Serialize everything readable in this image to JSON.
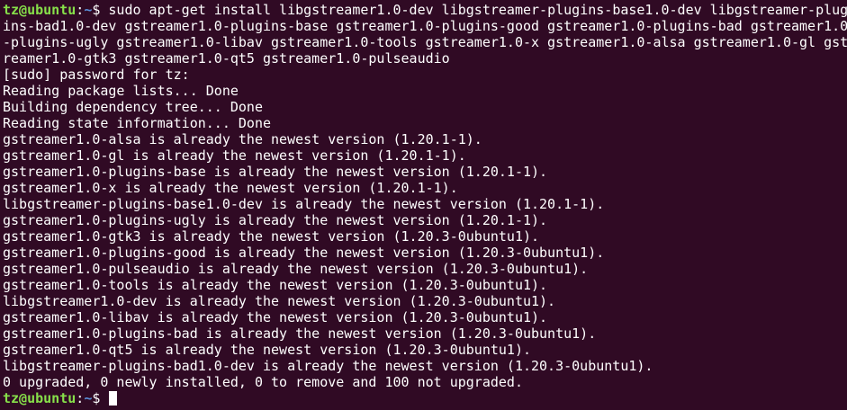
{
  "colors": {
    "background": "#300a24",
    "text": "#ffffff",
    "prompt_user": "#87e04a",
    "prompt_path": "#5a8fd8"
  },
  "prompt": {
    "user_host": "tz@ubuntu",
    "separator": ":",
    "path": "~",
    "symbol": "$ "
  },
  "command_lines": [
    "sudo apt-get install libgstreamer1.0-dev libgstreamer-plugins-base1.0-dev libgstreamer-plug",
    "ins-bad1.0-dev gstreamer1.0-plugins-base gstreamer1.0-plugins-good gstreamer1.0-plugins-bad gstreamer1.0",
    "-plugins-ugly gstreamer1.0-libav gstreamer1.0-tools gstreamer1.0-x gstreamer1.0-alsa gstreamer1.0-gl gst",
    "reamer1.0-gtk3 gstreamer1.0-qt5 gstreamer1.0-pulseaudio"
  ],
  "output_lines": [
    "[sudo] password for tz:",
    "Reading package lists... Done",
    "Building dependency tree... Done",
    "Reading state information... Done",
    "gstreamer1.0-alsa is already the newest version (1.20.1-1).",
    "gstreamer1.0-gl is already the newest version (1.20.1-1).",
    "gstreamer1.0-plugins-base is already the newest version (1.20.1-1).",
    "gstreamer1.0-x is already the newest version (1.20.1-1).",
    "libgstreamer-plugins-base1.0-dev is already the newest version (1.20.1-1).",
    "gstreamer1.0-plugins-ugly is already the newest version (1.20.1-1).",
    "gstreamer1.0-gtk3 is already the newest version (1.20.3-0ubuntu1).",
    "gstreamer1.0-plugins-good is already the newest version (1.20.3-0ubuntu1).",
    "gstreamer1.0-pulseaudio is already the newest version (1.20.3-0ubuntu1).",
    "gstreamer1.0-tools is already the newest version (1.20.3-0ubuntu1).",
    "libgstreamer1.0-dev is already the newest version (1.20.3-0ubuntu1).",
    "gstreamer1.0-libav is already the newest version (1.20.3-0ubuntu1).",
    "gstreamer1.0-plugins-bad is already the newest version (1.20.3-0ubuntu1).",
    "gstreamer1.0-qt5 is already the newest version (1.20.3-0ubuntu1).",
    "libgstreamer-plugins-bad1.0-dev is already the newest version (1.20.3-0ubuntu1).",
    "0 upgraded, 0 newly installed, 0 to remove and 100 not upgraded."
  ]
}
